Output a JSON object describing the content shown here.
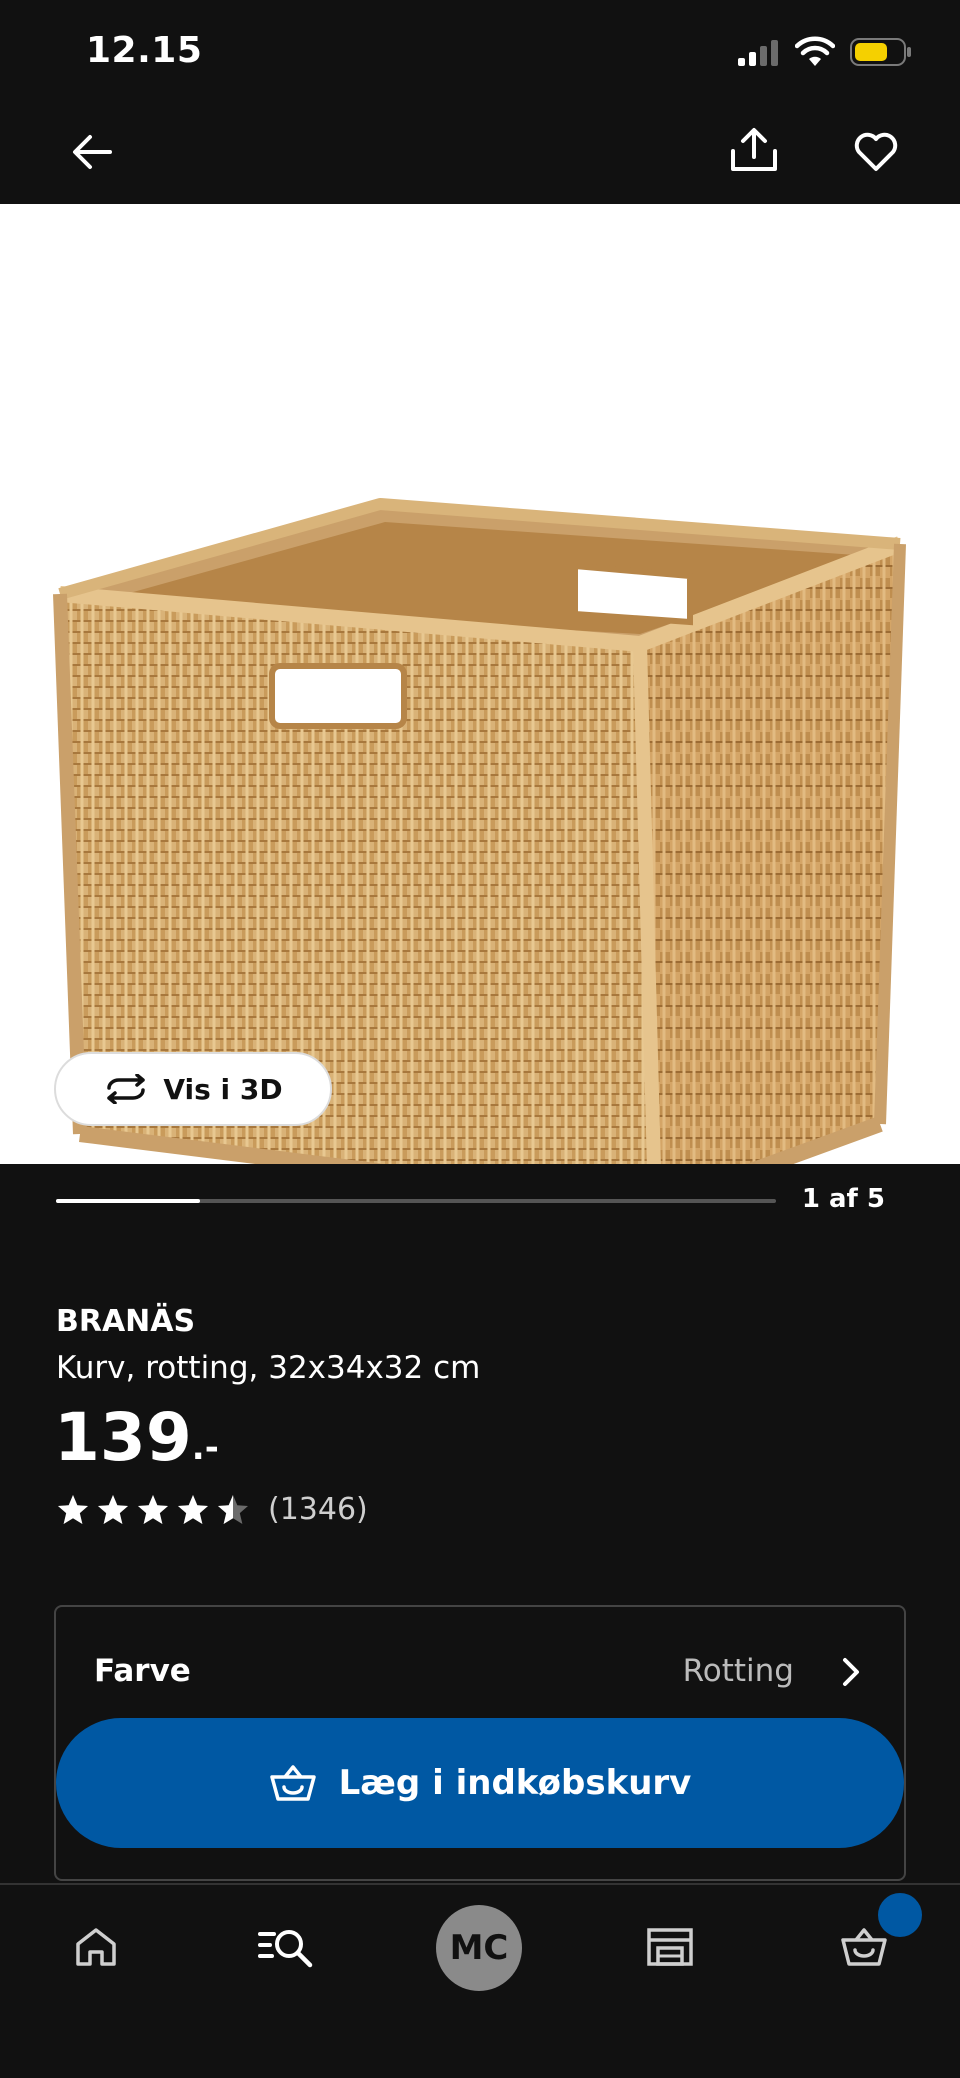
{
  "status_bar": {
    "time": "12.15",
    "icons": [
      "cellular-signal-icon",
      "wifi-icon",
      "battery-icon"
    ],
    "battery_color": "#f5d000"
  },
  "top_nav": {
    "icons": [
      "back-arrow-icon",
      "share-icon",
      "heart-icon"
    ]
  },
  "gallery": {
    "view_3d_label": "Vis i 3D",
    "view_3d_icon": "rotate-3d-icon",
    "pager_label": "1 af 5",
    "current_index": 1,
    "total": 5
  },
  "product": {
    "name": "BRANÄS",
    "description": "Kurv, rotting, 32x34x32 cm",
    "price": "139",
    "price_suffix": ".-",
    "rating_value": 4.5,
    "rating_max": 5,
    "rating_count": "(1346)"
  },
  "options": {
    "color_label": "Farve",
    "color_value": "Rotting",
    "chevron_icon": "chevron-right-icon"
  },
  "cart_button": {
    "label": "Læg i indkøbskurv",
    "icon": "shopping-basket-icon",
    "color": "#0058a3"
  },
  "tab_bar": {
    "items": [
      {
        "name": "home",
        "icon": "home-icon"
      },
      {
        "name": "search",
        "icon": "search-list-icon"
      },
      {
        "name": "profile",
        "label": "MC"
      },
      {
        "name": "store",
        "icon": "store-icon"
      },
      {
        "name": "cart",
        "icon": "cart-icon",
        "has_badge": true
      }
    ],
    "profile_initials": "MC",
    "badge_color": "#0058a3"
  },
  "colors": {
    "background": "#111111",
    "accent": "#0058a3"
  }
}
